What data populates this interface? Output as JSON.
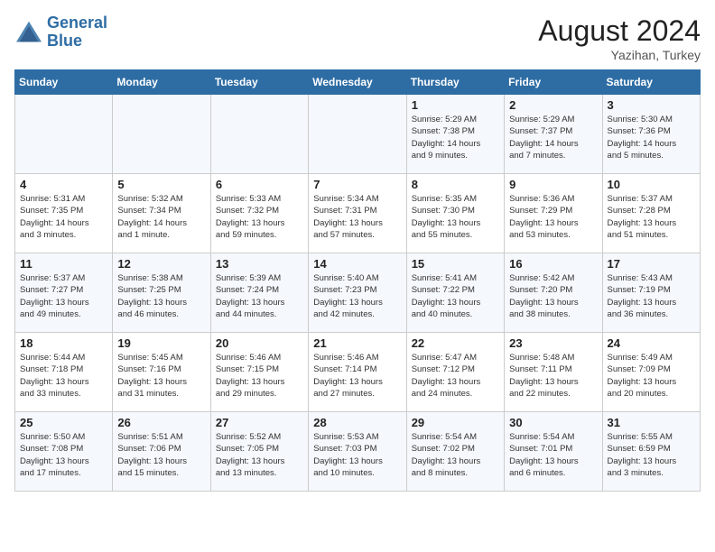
{
  "header": {
    "logo_line1": "General",
    "logo_line2": "Blue",
    "month_year": "August 2024",
    "location": "Yazihan, Turkey"
  },
  "weekdays": [
    "Sunday",
    "Monday",
    "Tuesday",
    "Wednesday",
    "Thursday",
    "Friday",
    "Saturday"
  ],
  "weeks": [
    [
      {
        "day": "",
        "info": ""
      },
      {
        "day": "",
        "info": ""
      },
      {
        "day": "",
        "info": ""
      },
      {
        "day": "",
        "info": ""
      },
      {
        "day": "1",
        "info": "Sunrise: 5:29 AM\nSunset: 7:38 PM\nDaylight: 14 hours\nand 9 minutes."
      },
      {
        "day": "2",
        "info": "Sunrise: 5:29 AM\nSunset: 7:37 PM\nDaylight: 14 hours\nand 7 minutes."
      },
      {
        "day": "3",
        "info": "Sunrise: 5:30 AM\nSunset: 7:36 PM\nDaylight: 14 hours\nand 5 minutes."
      }
    ],
    [
      {
        "day": "4",
        "info": "Sunrise: 5:31 AM\nSunset: 7:35 PM\nDaylight: 14 hours\nand 3 minutes."
      },
      {
        "day": "5",
        "info": "Sunrise: 5:32 AM\nSunset: 7:34 PM\nDaylight: 14 hours\nand 1 minute."
      },
      {
        "day": "6",
        "info": "Sunrise: 5:33 AM\nSunset: 7:32 PM\nDaylight: 13 hours\nand 59 minutes."
      },
      {
        "day": "7",
        "info": "Sunrise: 5:34 AM\nSunset: 7:31 PM\nDaylight: 13 hours\nand 57 minutes."
      },
      {
        "day": "8",
        "info": "Sunrise: 5:35 AM\nSunset: 7:30 PM\nDaylight: 13 hours\nand 55 minutes."
      },
      {
        "day": "9",
        "info": "Sunrise: 5:36 AM\nSunset: 7:29 PM\nDaylight: 13 hours\nand 53 minutes."
      },
      {
        "day": "10",
        "info": "Sunrise: 5:37 AM\nSunset: 7:28 PM\nDaylight: 13 hours\nand 51 minutes."
      }
    ],
    [
      {
        "day": "11",
        "info": "Sunrise: 5:37 AM\nSunset: 7:27 PM\nDaylight: 13 hours\nand 49 minutes."
      },
      {
        "day": "12",
        "info": "Sunrise: 5:38 AM\nSunset: 7:25 PM\nDaylight: 13 hours\nand 46 minutes."
      },
      {
        "day": "13",
        "info": "Sunrise: 5:39 AM\nSunset: 7:24 PM\nDaylight: 13 hours\nand 44 minutes."
      },
      {
        "day": "14",
        "info": "Sunrise: 5:40 AM\nSunset: 7:23 PM\nDaylight: 13 hours\nand 42 minutes."
      },
      {
        "day": "15",
        "info": "Sunrise: 5:41 AM\nSunset: 7:22 PM\nDaylight: 13 hours\nand 40 minutes."
      },
      {
        "day": "16",
        "info": "Sunrise: 5:42 AM\nSunset: 7:20 PM\nDaylight: 13 hours\nand 38 minutes."
      },
      {
        "day": "17",
        "info": "Sunrise: 5:43 AM\nSunset: 7:19 PM\nDaylight: 13 hours\nand 36 minutes."
      }
    ],
    [
      {
        "day": "18",
        "info": "Sunrise: 5:44 AM\nSunset: 7:18 PM\nDaylight: 13 hours\nand 33 minutes."
      },
      {
        "day": "19",
        "info": "Sunrise: 5:45 AM\nSunset: 7:16 PM\nDaylight: 13 hours\nand 31 minutes."
      },
      {
        "day": "20",
        "info": "Sunrise: 5:46 AM\nSunset: 7:15 PM\nDaylight: 13 hours\nand 29 minutes."
      },
      {
        "day": "21",
        "info": "Sunrise: 5:46 AM\nSunset: 7:14 PM\nDaylight: 13 hours\nand 27 minutes."
      },
      {
        "day": "22",
        "info": "Sunrise: 5:47 AM\nSunset: 7:12 PM\nDaylight: 13 hours\nand 24 minutes."
      },
      {
        "day": "23",
        "info": "Sunrise: 5:48 AM\nSunset: 7:11 PM\nDaylight: 13 hours\nand 22 minutes."
      },
      {
        "day": "24",
        "info": "Sunrise: 5:49 AM\nSunset: 7:09 PM\nDaylight: 13 hours\nand 20 minutes."
      }
    ],
    [
      {
        "day": "25",
        "info": "Sunrise: 5:50 AM\nSunset: 7:08 PM\nDaylight: 13 hours\nand 17 minutes."
      },
      {
        "day": "26",
        "info": "Sunrise: 5:51 AM\nSunset: 7:06 PM\nDaylight: 13 hours\nand 15 minutes."
      },
      {
        "day": "27",
        "info": "Sunrise: 5:52 AM\nSunset: 7:05 PM\nDaylight: 13 hours\nand 13 minutes."
      },
      {
        "day": "28",
        "info": "Sunrise: 5:53 AM\nSunset: 7:03 PM\nDaylight: 13 hours\nand 10 minutes."
      },
      {
        "day": "29",
        "info": "Sunrise: 5:54 AM\nSunset: 7:02 PM\nDaylight: 13 hours\nand 8 minutes."
      },
      {
        "day": "30",
        "info": "Sunrise: 5:54 AM\nSunset: 7:01 PM\nDaylight: 13 hours\nand 6 minutes."
      },
      {
        "day": "31",
        "info": "Sunrise: 5:55 AM\nSunset: 6:59 PM\nDaylight: 13 hours\nand 3 minutes."
      }
    ]
  ]
}
